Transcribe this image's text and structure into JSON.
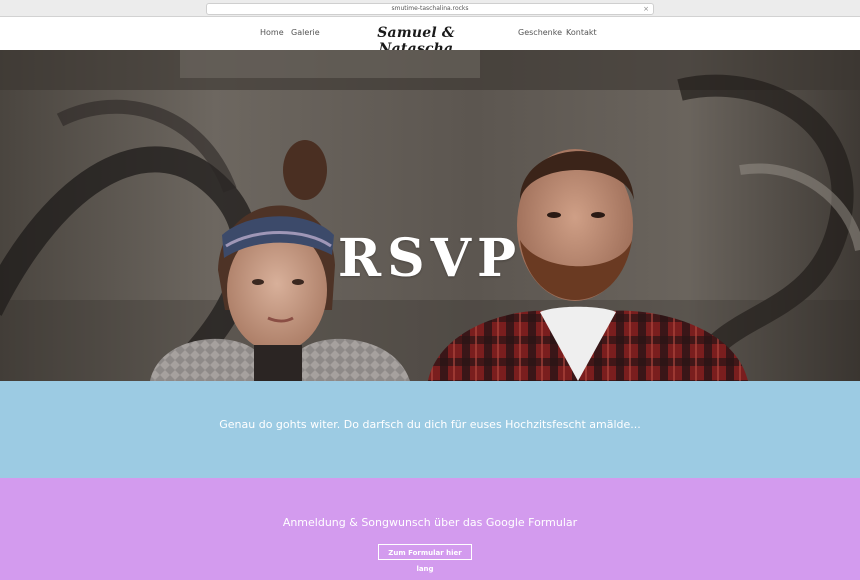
{
  "browser": {
    "url": "smutime-taschalina.rocks",
    "close_glyph": "×"
  },
  "nav": {
    "logo": "Samuel & Natascha",
    "items": [
      {
        "label": "Home"
      },
      {
        "label": "Galerie"
      },
      {
        "label": "Geschenke"
      },
      {
        "label": "Kontakt"
      }
    ]
  },
  "hero": {
    "title": "RSVP",
    "image": "couple-photo-graffiti-wall"
  },
  "intro": {
    "text": "Genau do gohts witer. Do darfsch du dich für euses Hochzitsfescht amälde..."
  },
  "form_section": {
    "heading": "Anmeldung & Songwunsch über das Google Formular",
    "button_label": "Zum Formular hier lang"
  },
  "colors": {
    "blue_section": "#9ccbe3",
    "purple_section": "#d39bee",
    "text_on_color": "#ffffff"
  }
}
